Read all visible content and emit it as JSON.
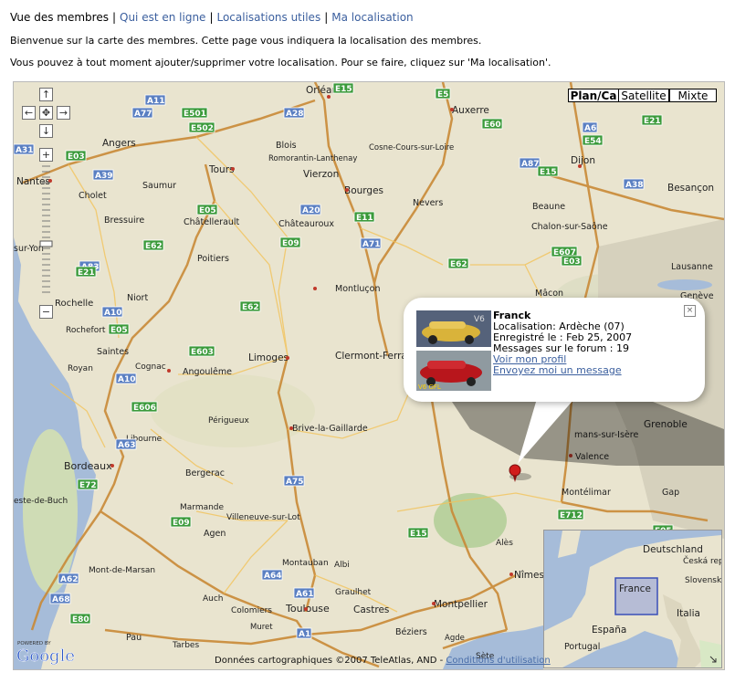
{
  "nav": {
    "current": "Vue des membres",
    "links": [
      "Qui est en ligne",
      "Localisations utiles",
      "Ma localisation"
    ],
    "separator": "|"
  },
  "intro": {
    "line1": "Bienvenue sur la carte des membres. Cette page vous indiquera la localisation des membres.",
    "line2": "Vous pouvez à tout moment ajouter/supprimer votre localisation. Pour se faire, cliquez sur 'Ma localisation'."
  },
  "map": {
    "type_buttons": [
      "Plan/Ca",
      "Satellite",
      "Mixte"
    ],
    "controls": {
      "pan_up": "↑",
      "pan_left": "←",
      "pan_center": "✥",
      "pan_right": "→",
      "pan_down": "↓",
      "zoom_in": "+",
      "zoom_out": "−"
    },
    "cities": [
      "Orléans",
      "Auxerre",
      "Angers",
      "Blois",
      "Romorantin-Lanthenay",
      "Cosne-Cours-sur-Loire",
      "Dijon",
      "Tours",
      "Vierzon",
      "Nantes",
      "Saumur",
      "Bourges",
      "Nevers",
      "Cholet",
      "Beaune",
      "Besançon",
      "Bressuire",
      "Châtellerault",
      "Châteauroux",
      "Chalon-sur-Saône",
      "sur-Yon",
      "Poitiers",
      "Montluçon",
      "Mâcon",
      "Lausanne",
      "Rochelle",
      "Niort",
      "Genève",
      "Rochefort",
      "Saintes",
      "Limoges",
      "Clermont-Ferra",
      "Royan",
      "Cognac",
      "Angoulême",
      "Périgueux",
      "Brive-la-Gaillarde",
      "Libourne",
      "Grenoble",
      "mans-sur-Isère",
      "Bordeaux",
      "Valence",
      "Bergerac",
      "Montélimar",
      "Gap",
      "este-de-Buch",
      "Marmande",
      "Villeneuve-sur-Lot",
      "Agen",
      "Alès",
      "Mont-de-Marsan",
      "Montauban",
      "Albi",
      "Nîmes",
      "Auch",
      "Graulhet",
      "Montpellier",
      "Toulouse",
      "Castres",
      "Colomiers",
      "Muret",
      "Béziers",
      "Agde",
      "Pau",
      "Tarbes",
      "Sète"
    ],
    "roads": [
      "A11",
      "E5",
      "E15",
      "A77",
      "E501",
      "E502",
      "A28",
      "E60",
      "A6",
      "E21",
      "E54",
      "A31",
      "E03",
      "A87",
      "E15",
      "A38",
      "A39",
      "E05",
      "A20",
      "E11",
      "E62",
      "A71",
      "E607",
      "E09",
      "E62",
      "A83",
      "E03",
      "E62",
      "E21",
      "A10",
      "E05",
      "E603",
      "A10",
      "E606",
      "A63",
      "E72",
      "E09",
      "A75",
      "E15",
      "E712",
      "E05",
      "A62",
      "A68",
      "A64",
      "A61",
      "E80",
      "A1"
    ],
    "copyright": "Données cartographiques ©2007 TeleAtlas, AND -",
    "terms": "Conditions d'utilisation",
    "google_logo": "Google",
    "powered_by": "POWERED BY"
  },
  "infowindow": {
    "name": "Franck",
    "location": "Localisation: Ardèche (07)",
    "registered": "Enregistré le : Feb 25, 2007",
    "messages": "Messages sur le forum : 19",
    "profile_link": "Voir mon profil",
    "message_link": "Envoyez moi un message",
    "close_icon": "×",
    "car_labels": [
      "V6",
      "V6 GFL"
    ]
  },
  "overview_map": {
    "labels": [
      "Deutschland",
      "Česká rep.",
      "Slovensko",
      "France",
      "Italia",
      "España",
      "Portugal"
    ]
  },
  "colors": {
    "link": "#3b5f9e",
    "map_land": "#e9e4cf",
    "water": "#a6bcd9",
    "highway": "#c98a37",
    "road_shield_blue": "#5a7fc2",
    "road_shield_green": "#3a9a3a"
  }
}
